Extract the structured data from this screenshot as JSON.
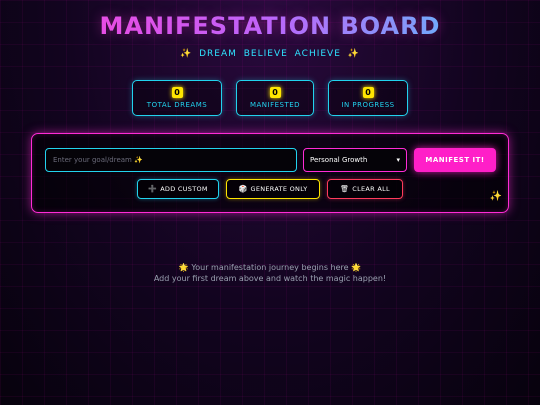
{
  "header": {
    "title": "MANIFESTATION BOARD",
    "subtitle": "✨ DREAM  BELIEVE  ACHIEVE ✨"
  },
  "stats": [
    {
      "value": "0",
      "label": "TOTAL DREAMS"
    },
    {
      "value": "0",
      "label": "MANIFESTED"
    },
    {
      "value": "0",
      "label": "IN PROGRESS"
    }
  ],
  "form": {
    "goal_placeholder": "Enter your goal/dream ✨",
    "goal_value": "",
    "category_selected": "Personal Growth",
    "manifest_label": "MANIFEST IT!"
  },
  "actions": {
    "add_custom_icon": "➕",
    "add_custom_label": "ADD CUSTOM",
    "generate_icon": "🎲",
    "generate_label": "GENERATE ONLY",
    "clear_icon": "🗑",
    "clear_label": "CLEAR ALL"
  },
  "empty_state": {
    "line1": "🌟 Your manifestation journey begins here 🌟",
    "line2": "Add your first dream above and watch the magic happen!"
  },
  "colors": {
    "accent_pink": "#ff1fc8",
    "accent_cyan": "#22d3ee",
    "accent_yellow": "#ffe600",
    "accent_red": "#ff3b5c"
  }
}
